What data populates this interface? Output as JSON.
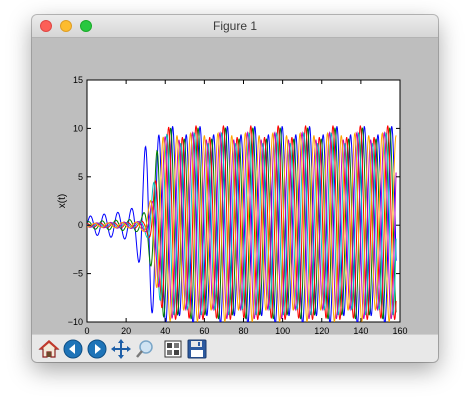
{
  "window": {
    "title": "Figure 1"
  },
  "toolbar": {
    "buttons": [
      {
        "name": "home-button",
        "icon": "home-icon"
      },
      {
        "name": "back-button",
        "icon": "back-arrow-icon"
      },
      {
        "name": "forward-button",
        "icon": "forward-arrow-icon"
      },
      {
        "name": "pan-button",
        "icon": "move-arrows-icon"
      },
      {
        "name": "zoom-button",
        "icon": "zoom-rect-icon"
      },
      {
        "name": "configure-subplots-button",
        "icon": "subplots-icon"
      },
      {
        "name": "save-button",
        "icon": "floppy-disk-icon"
      }
    ]
  },
  "chart_data": {
    "type": "line",
    "xlabel": "t",
    "ylabel": "x(t)",
    "xlim": [
      0,
      160
    ],
    "ylim": [
      -10,
      15
    ],
    "xticks": [
      "0",
      "20",
      "40",
      "60",
      "80",
      "100",
      "120",
      "140",
      "160"
    ],
    "yticks": [
      "−10",
      "−5",
      "0",
      "5",
      "10",
      "15"
    ],
    "xtick_values": [
      0,
      20,
      40,
      60,
      80,
      100,
      120,
      140,
      160
    ],
    "ytick_values": [
      -10,
      -5,
      0,
      5,
      10,
      15
    ],
    "grid": false,
    "series": [
      {
        "color": "#0000ff",
        "period": 7.0,
        "amp_max": 9.8,
        "onset": 28,
        "phase": 0.0,
        "small_amp": 1.5
      },
      {
        "color": "#008000",
        "period": 7.0,
        "amp_max": 9.5,
        "onset": 33,
        "phase": 0.9,
        "small_amp": 0.6
      },
      {
        "color": "#ff0000",
        "period": 7.0,
        "amp_max": 9.7,
        "onset": 35,
        "phase": 1.8,
        "small_amp": 0.3
      },
      {
        "color": "#00bfbf",
        "period": 7.0,
        "amp_max": 9.0,
        "onset": 34,
        "phase": 2.6,
        "small_amp": 0.3
      },
      {
        "color": "#bf00bf",
        "period": 7.0,
        "amp_max": 9.2,
        "onset": 35,
        "phase": 3.4,
        "small_amp": 0.35
      },
      {
        "color": "#ffa500",
        "period": 7.0,
        "amp_max": 9.4,
        "onset": 34,
        "phase": 4.3,
        "small_amp": 0.3
      }
    ]
  }
}
